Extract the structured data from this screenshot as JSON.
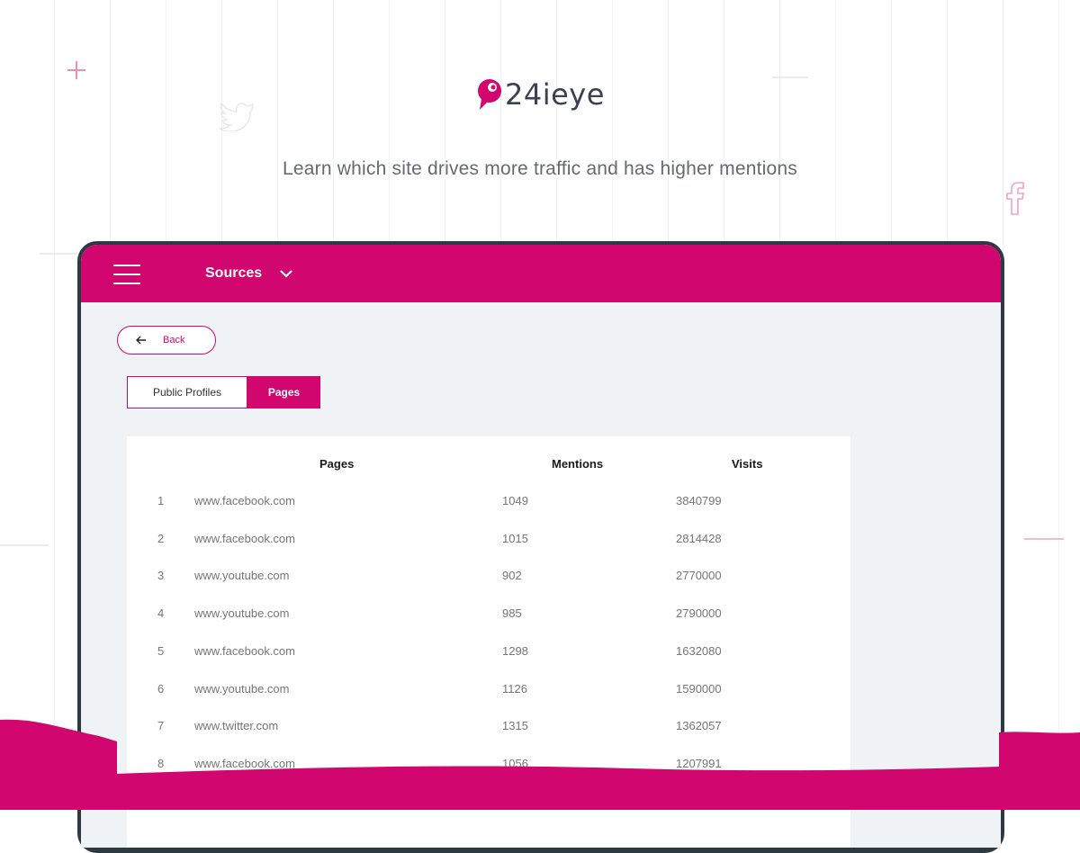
{
  "brand": {
    "name": "24ieye",
    "accent": "#d2066f",
    "dark": "#2e3a42"
  },
  "tagline": "Learn which site drives more traffic and has higher mentions",
  "appbar": {
    "title": "Sources"
  },
  "back_label": "Back",
  "tabs": [
    {
      "label": "Public Profiles",
      "active": false
    },
    {
      "label": "Pages",
      "active": true
    }
  ],
  "table": {
    "headers": {
      "pages": "Pages",
      "mentions": "Mentions",
      "visits": "Visits"
    },
    "rows": [
      {
        "n": "1",
        "page": "www.facebook.com",
        "mentions": "1049",
        "visits": "3840799"
      },
      {
        "n": "2",
        "page": "www.facebook.com",
        "mentions": "1015",
        "visits": "2814428"
      },
      {
        "n": "3",
        "page": "www.youtube.com",
        "mentions": "902",
        "visits": "2770000"
      },
      {
        "n": "4",
        "page": "www.youtube.com",
        "mentions": "985",
        "visits": "2790000"
      },
      {
        "n": "5",
        "page": "www.facebook.com",
        "mentions": "1298",
        "visits": "1632080"
      },
      {
        "n": "6",
        "page": "www.youtube.com",
        "mentions": "1126",
        "visits": "1590000"
      },
      {
        "n": "7",
        "page": "www.twitter.com",
        "mentions": "1315",
        "visits": "1362057"
      },
      {
        "n": "8",
        "page": "www.facebook.com",
        "mentions": "1056",
        "visits": "1207991"
      }
    ]
  },
  "icons": [
    "plus-icon",
    "twitter-bird-icon",
    "facebook-icon",
    "menu-icon",
    "chevron-down-icon",
    "arrow-left-icon",
    "logo-pin-icon"
  ]
}
